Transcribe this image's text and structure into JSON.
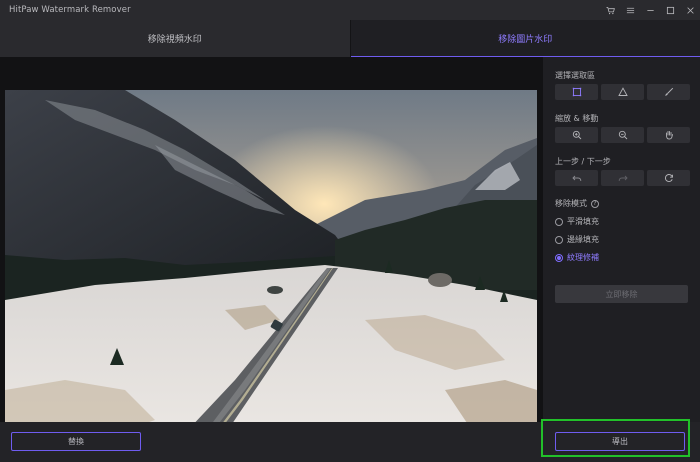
{
  "app": {
    "title": "HitPaw Watermark Remover"
  },
  "tabs": [
    {
      "label": "移除視頻水印",
      "active": false
    },
    {
      "label": "移除圖片水印",
      "active": true
    }
  ],
  "panel": {
    "select_area": {
      "label": "選擇選取區",
      "tools": [
        "rectangle-select-icon",
        "polygon-select-icon",
        "brush-icon"
      ]
    },
    "zoom_move": {
      "label": "縮放 & 移動",
      "tools": [
        "zoom-in-icon",
        "zoom-out-icon",
        "hand-icon"
      ]
    },
    "undo_redo": {
      "label": "上一步 / 下一步",
      "tools": [
        "undo-icon",
        "redo-icon",
        "reset-icon"
      ]
    },
    "mode": {
      "label": "移除模式",
      "options": [
        {
          "label": "平滑填充",
          "selected": false
        },
        {
          "label": "邊緣填充",
          "selected": false
        },
        {
          "label": "紋理修補",
          "selected": true
        }
      ]
    },
    "remove_now": "立即移除"
  },
  "bottom": {
    "replace": "替換",
    "export": "導出"
  },
  "colors": {
    "accent": "#7f6cff",
    "highlight_frame": "#22c02a",
    "background": "#1f1f23"
  }
}
